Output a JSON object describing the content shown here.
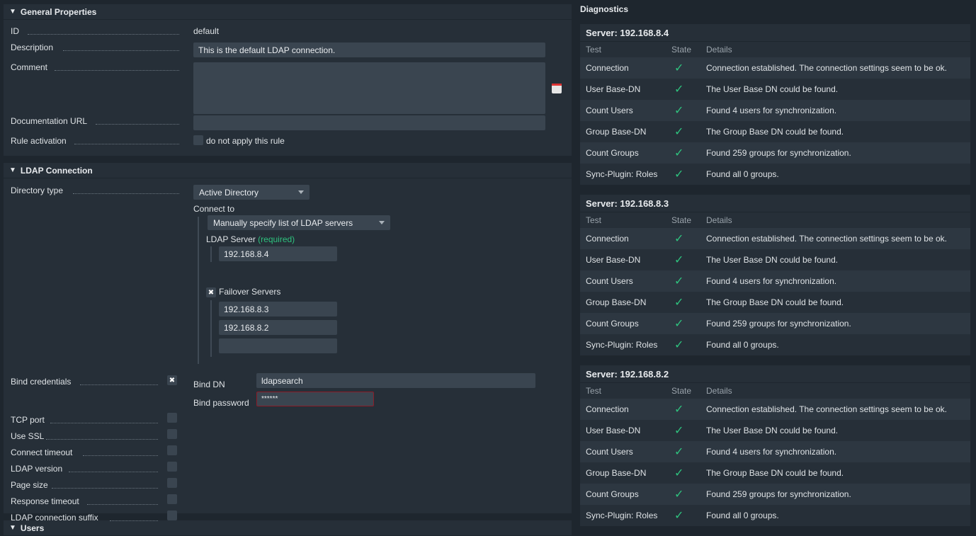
{
  "general": {
    "title": "General Properties",
    "id_label": "ID",
    "id_value": "default",
    "description_label": "Description",
    "description_value": "This is the default LDAP connection.",
    "comment_label": "Comment",
    "doc_url_label": "Documentation URL",
    "rule_activation_label": "Rule activation",
    "rule_activation_text": "do not apply this rule"
  },
  "ldap": {
    "title": "LDAP Connection",
    "directory_type_label": "Directory type",
    "directory_type_value": "Active Directory",
    "connect_to_label": "Connect to",
    "connect_to_value": "Manually specify list of LDAP servers",
    "ldap_server_label": "LDAP Server",
    "required_text": "(required)",
    "ldap_server_value": "192.168.8.4",
    "failover_label": "Failover Servers",
    "failover_1": "192.168.8.3",
    "failover_2": "192.168.8.2",
    "failover_3": "",
    "bind_credentials_label": "Bind credentials",
    "bind_dn_label": "Bind DN",
    "bind_dn_value": "ldapsearch",
    "bind_password_label": "Bind password",
    "bind_password_value": "******",
    "tcp_port_label": "TCP port",
    "use_ssl_label": "Use SSL",
    "connect_timeout_label": "Connect timeout",
    "ldap_version_label": "LDAP version",
    "page_size_label": "Page size",
    "response_timeout_label": "Response timeout",
    "suffix_label": "LDAP connection suffix"
  },
  "users": {
    "title": "Users"
  },
  "diagnostics": {
    "title": "Diagnostics",
    "columns": {
      "test": "Test",
      "state": "State",
      "details": "Details"
    },
    "servers": [
      {
        "title": "Server: 192.168.8.4",
        "rows": [
          {
            "test": "Connection",
            "details": "Connection established. The connection settings seem to be ok."
          },
          {
            "test": "User Base-DN",
            "details": "The User Base DN could be found."
          },
          {
            "test": "Count Users",
            "details": "Found 4 users for synchronization."
          },
          {
            "test": "Group Base-DN",
            "details": "The Group Base DN could be found."
          },
          {
            "test": "Count Groups",
            "details": "Found 259 groups for synchronization."
          },
          {
            "test": "Sync-Plugin: Roles",
            "details": "Found all 0 groups."
          }
        ]
      },
      {
        "title": "Server: 192.168.8.3",
        "rows": [
          {
            "test": "Connection",
            "details": "Connection established. The connection settings seem to be ok."
          },
          {
            "test": "User Base-DN",
            "details": "The User Base DN could be found."
          },
          {
            "test": "Count Users",
            "details": "Found 4 users for synchronization."
          },
          {
            "test": "Group Base-DN",
            "details": "The Group Base DN could be found."
          },
          {
            "test": "Count Groups",
            "details": "Found 259 groups for synchronization."
          },
          {
            "test": "Sync-Plugin: Roles",
            "details": "Found all 0 groups."
          }
        ]
      },
      {
        "title": "Server: 192.168.8.2",
        "rows": [
          {
            "test": "Connection",
            "details": "Connection established. The connection settings seem to be ok."
          },
          {
            "test": "User Base-DN",
            "details": "The User Base DN could be found."
          },
          {
            "test": "Count Users",
            "details": "Found 4 users for synchronization."
          },
          {
            "test": "Group Base-DN",
            "details": "The Group Base DN could be found."
          },
          {
            "test": "Count Groups",
            "details": "Found 259 groups for synchronization."
          },
          {
            "test": "Sync-Plugin: Roles",
            "details": "Found all 0 groups."
          }
        ]
      }
    ]
  },
  "icons": {
    "state_ok": "check-icon",
    "collapse": "triangle-down-icon",
    "failover_checkbox": "checked-icon",
    "date_picker": "calendar-clock-icon"
  },
  "colors": {
    "background": "#1e262e",
    "panel": "#262f38",
    "input": "#3a4550",
    "ok": "#2ec27e",
    "required": "#2ec27e",
    "password_border": "#8b1c28"
  }
}
